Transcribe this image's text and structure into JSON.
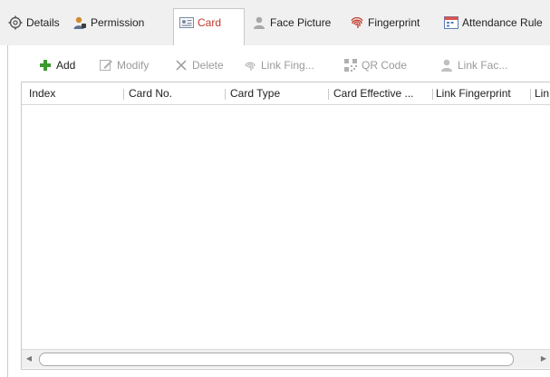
{
  "tabs": [
    {
      "label": "Details",
      "icon": "gear-icon",
      "active": false
    },
    {
      "label": "Permission",
      "icon": "person-key-icon",
      "active": false
    },
    {
      "label": "Card",
      "icon": "card-icon",
      "active": true
    },
    {
      "label": "Face Picture",
      "icon": "person-icon",
      "active": false
    },
    {
      "label": "Fingerprint",
      "icon": "fingerprint-icon",
      "active": false
    },
    {
      "label": "Attendance Rule",
      "icon": "calendar-icon",
      "active": false
    }
  ],
  "toolbar": {
    "add_label": "Add",
    "modify_label": "Modify",
    "delete_label": "Delete",
    "link_fingerprint_label": "Link Fing...",
    "qr_code_label": "QR Code",
    "link_face_label": "Link Fac..."
  },
  "table": {
    "columns": [
      "Index",
      "Card No.",
      "Card Type",
      "Card Effective ...",
      "Link Fingerprint",
      "Lin"
    ],
    "rows": []
  },
  "colors": {
    "active_tab_text": "#c0392b",
    "add_icon": "#3a9a2c",
    "disabled_text": "#9a9a9a",
    "border": "#c9c9c9"
  }
}
